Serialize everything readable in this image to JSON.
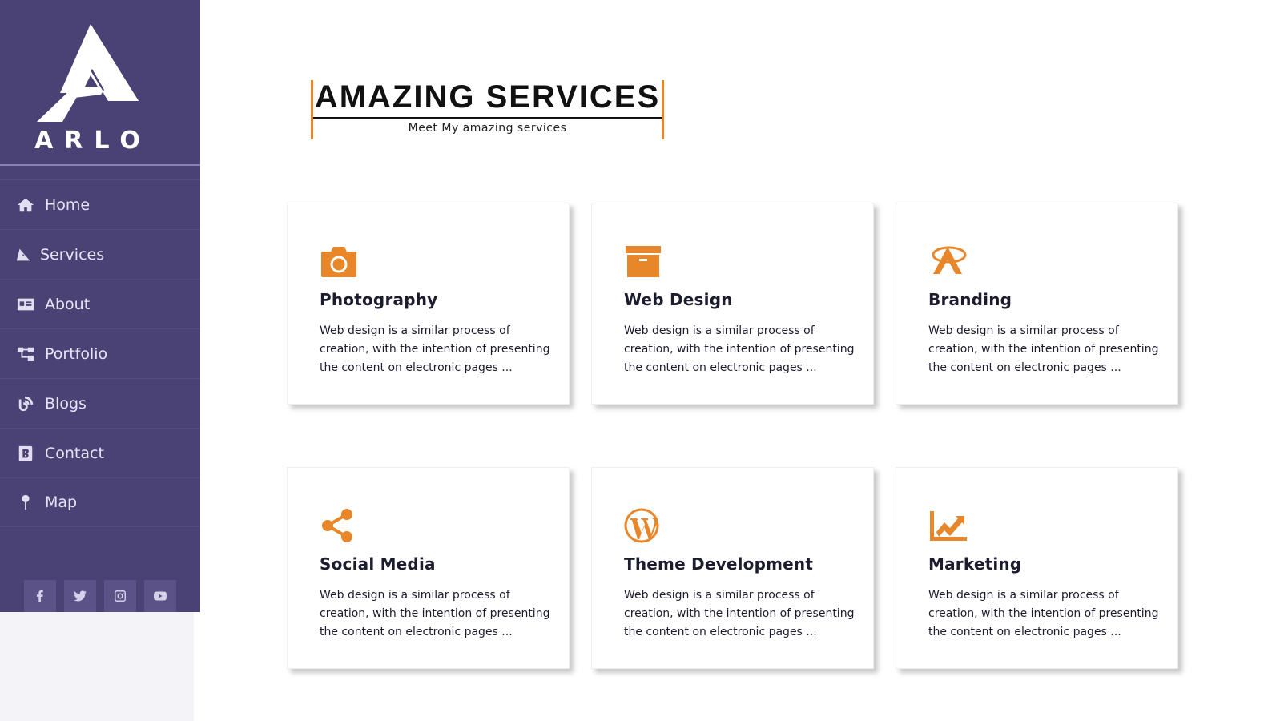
{
  "brand": {
    "name": "ARLO"
  },
  "nav": [
    {
      "label": "Home",
      "icon": "home-icon"
    },
    {
      "label": "Services",
      "icon": "services-icon"
    },
    {
      "label": "About",
      "icon": "id-card-icon"
    },
    {
      "label": "Portfolio",
      "icon": "sitemap-icon"
    },
    {
      "label": "Blogs",
      "icon": "blog-icon"
    },
    {
      "label": "Contact",
      "icon": "address-book-icon"
    },
    {
      "label": "Map",
      "icon": "map-pin-icon"
    }
  ],
  "socials": [
    "facebook-icon",
    "twitter-icon",
    "instagram-icon",
    "youtube-icon"
  ],
  "section": {
    "title": "AMAZING SERVICES",
    "subtitle": "Meet My amazing services"
  },
  "services": [
    {
      "title": "Photography",
      "icon": "camera-icon",
      "desc": "Web design is a similar process of creation, with the intention of presenting the content on electronic pages ..."
    },
    {
      "title": "Web Design",
      "icon": "archive-icon",
      "desc": "Web design is a similar process of creation, with the intention of presenting the content on electronic pages ..."
    },
    {
      "title": "Branding",
      "icon": "brand-logo-icon",
      "desc": "Web design is a similar process of creation, with the intention of presenting the content on electronic pages ..."
    },
    {
      "title": "Social Media",
      "icon": "share-icon",
      "desc": "Web design is a similar process of creation, with the intention of presenting the content on electronic pages ..."
    },
    {
      "title": "Theme Development",
      "icon": "wordpress-icon",
      "desc": "Web design is a similar process of creation, with the intention of presenting the content on electronic pages ..."
    },
    {
      "title": "Marketing",
      "icon": "chart-line-icon",
      "desc": "Web design is a similar process of creation, with the intention of presenting the content on electronic pages ..."
    }
  ],
  "colors": {
    "sidebar": "#4a4274",
    "accent": "#e8862a",
    "text": "#1c1c2e"
  }
}
